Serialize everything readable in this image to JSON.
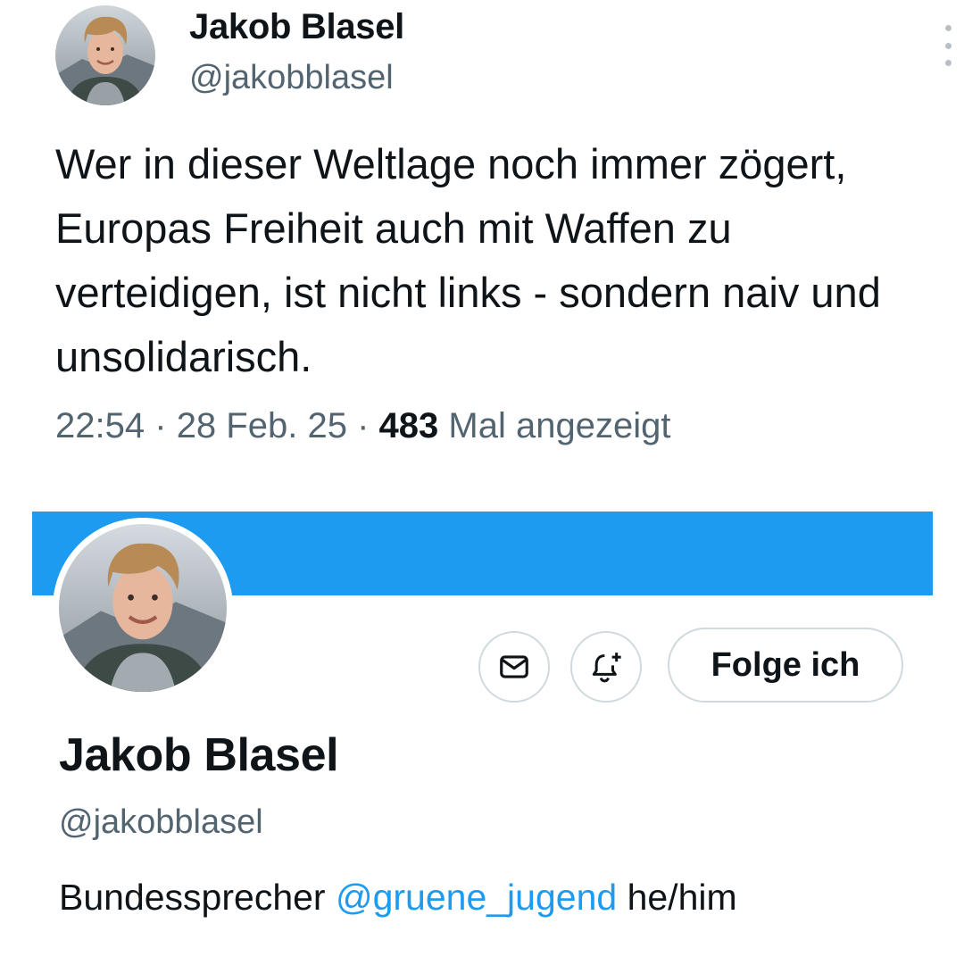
{
  "tweet": {
    "author_name": "Jakob Blasel",
    "author_handle": "@jakobblasel",
    "more_icon": "more-vertical-icon",
    "text": "Wer in dieser Weltlage noch immer zögert, Europas Freiheit auch mit Waffen zu verteidigen, ist nicht links - sondern naiv und unsolidarisch.",
    "time": "22:54",
    "separator": "·",
    "date": "28 Feb. 25",
    "views_count": "483",
    "views_label": "Mal angezeigt"
  },
  "profile": {
    "banner_color": "#1d9bf0",
    "name": "Jakob Blasel",
    "handle": "@jakobblasel",
    "message_icon": "envelope-icon",
    "notify_icon": "bell-plus-icon",
    "follow_label": "Folge ich",
    "bio_prefix": "Bundessprecher ",
    "bio_link": "@gruene_jugend",
    "bio_suffix": " he/him"
  },
  "colors": {
    "accent": "#1d9bf0",
    "text_primary": "#0f1419",
    "text_secondary": "#536471",
    "border": "#cfd9de"
  }
}
